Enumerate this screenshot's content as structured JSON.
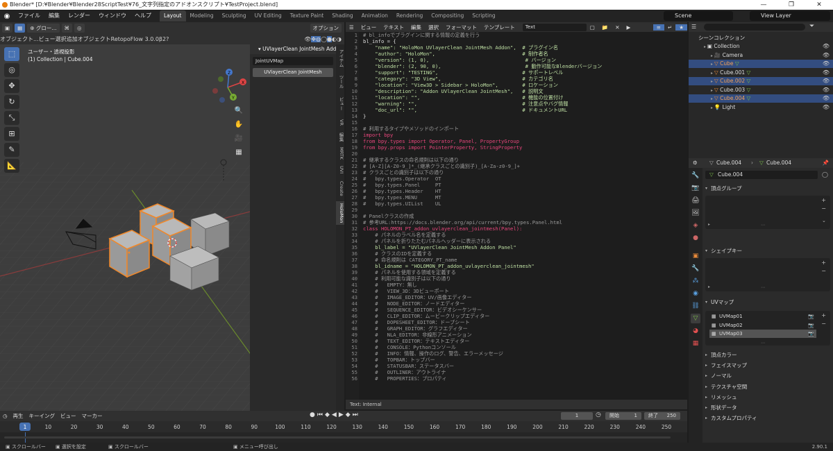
{
  "window": {
    "title": "Blender* [D:¥Blender¥Blender28ScriptTest¥76_文字列指定のアドオンスクリプト¥TestProject.blend]",
    "controls": [
      "—",
      "❐",
      "✕"
    ]
  },
  "menu": [
    "ファイル",
    "編集",
    "レンダー",
    "ウィンドウ",
    "ヘルプ"
  ],
  "workspaces": [
    "Layout",
    "Modeling",
    "Sculpting",
    "UV Editing",
    "Texture Paint",
    "Shading",
    "Animation",
    "Rendering",
    "Compositing",
    "Scripting"
  ],
  "active_workspace": "Layout",
  "scene": "Scene",
  "view_layer": "View Layer",
  "viewport": {
    "mode": "オブジェクト...",
    "orientation": "グロー...",
    "menus": [
      "ビュー",
      "選択",
      "追加",
      "オブジェクト"
    ],
    "addon_label": "RetopoFlow 3.0.0β2",
    "options_label": "オプション",
    "view_name": "ユーザー・透視投影",
    "collection_info": "(1) Collection | Cube.004",
    "tool_icons": [
      "select-box-icon",
      "cursor-icon",
      "move-icon",
      "rotate-icon",
      "scale-icon",
      "transform-icon",
      "annotate-icon",
      "measure-icon"
    ],
    "gizmo_axes": [
      "X",
      "Y",
      "Z"
    ]
  },
  "npanel": {
    "panel_title": "UVlayerClean JointMesh Addon",
    "input_value": "JointUVMap",
    "button_label": "UVlayerClean JointMesh",
    "tabs": [
      "アイテム",
      "ツール",
      "ビュー",
      "VR",
      "編集",
      "MRTK",
      "UVI",
      "Create",
      "HoloMon"
    ],
    "active_tab": "HoloMon"
  },
  "text_editor": {
    "menus": [
      "ビュー",
      "テキスト",
      "編集",
      "選択",
      "フォーマット",
      "テンプレート"
    ],
    "text_name": "Text",
    "footer": "Text: Internal",
    "lines": [
      "# bl_infoでプラグインに関する情報の定義を行う",
      "bl_info = {",
      "    \"name\": \"HoloMon UVlayerClean JointMesh Addon\",  # プラグイン名",
      "    \"author\": \"HoloMon\",                             # 制作者名",
      "    \"version\": (1, 0),                                # バージョン",
      "    \"blender\": (2, 90, 0),                            # 動作可能なBlenderバージョン",
      "    \"support\": \"TESTING\",                            # サポートレベル",
      "    \"category\": \"3D View\",                           # カテゴリ名",
      "    \"location\": \"View3D > Sidebar > HoloMon\",        # ロケーション",
      "    \"description\": \"Addon UVlayerClean JointMesh\",   # 説明文",
      "    \"location\": \"\",                                  # 機能の位置付け",
      "    \"warning\": \"\",                                   # 注意点やバグ情報",
      "    \"doc_url\": \"\",                                   # ドキュメントURL",
      "}",
      "",
      "# 利用するタイプやメソッドのインポート",
      "import bpy",
      "from bpy.types import Operator, Panel, PropertyGroup",
      "from bpy.props import PointerProperty, StringProperty",
      "",
      "# 継承するクラスの命名規則は以下の通り",
      "# [A-Z][A-Z0-9_]*_(継承クラスごとの識別子)_[A-Za-z0-9_]+",
      "# クラスごとの識別子は以下の通り",
      "#   bpy.types.Operator  OT",
      "#   bpy.types.Panel     PT",
      "#   bpy.types.Header    HT",
      "#   bpy.types.MENU      MT",
      "#   bpy.types.UIList    UL",
      "",
      "# Panelクラスの作成",
      "# 参考URL:https://docs.blender.org/api/current/bpy.types.Panel.html",
      "class HOLOMON_PT_addon_uvlayerclean_jointmesh(Panel):",
      "    # パネルのラベル名を定義する",
      "    # パネルを折りたたむパネルヘッダーに表示される",
      "    bl_label = \"UVlayerClean JointMesh Addon Panel\"",
      "    # クラスのIDを定義する",
      "    # 命名規則は CATEGORY_PT_name",
      "    bl_idname = \"HOLOMON_PT_addon_uvlayerclean_jointmesh\"",
      "    # パネルを使用する領域を定義する",
      "    # 利用可能な識別子は以下の通り",
      "    #   EMPTY：無し",
      "    #   VIEW_3D：3Dビューポート",
      "    #   IMAGE_EDITOR：UV/画像エディター",
      "    #   NODE_EDITOR：ノードエディター",
      "    #   SEQUENCE_EDITOR：ビデオシーケンサー",
      "    #   CLIP_EDITOR：ムービークリップエディター",
      "    #   DOPESHEET_EDITOR：ドープシート",
      "    #   GRAPH_EDITOR：グラフエディター",
      "    #   NLA_EDITOR：非線形アニメーション",
      "    #   TEXT_EDITOR：テキストエディター",
      "    #   CONSOLE：Pythonコンソール",
      "    #   INFO：情報、操作のログ、警告、エラーメッセージ",
      "    #   TOPBAR：トップバー",
      "    #   STATUSBAR：ステータスバー",
      "    #   OUTLINER：アウトライナ",
      "    #   PROPERTIES：プロパティ"
    ]
  },
  "outliner": {
    "root": "シーンコレクション",
    "items": [
      {
        "label": "Collection",
        "icon": "collection-icon",
        "selected": false,
        "level": 1
      },
      {
        "label": "Camera",
        "icon": "camera-icon",
        "selected": false,
        "level": 2
      },
      {
        "label": "Cube",
        "icon": "mesh-icon",
        "selected": true,
        "level": 2
      },
      {
        "label": "Cube.001",
        "icon": "mesh-icon",
        "selected": false,
        "level": 2
      },
      {
        "label": "Cube.002",
        "icon": "mesh-icon",
        "selected": true,
        "level": 2
      },
      {
        "label": "Cube.003",
        "icon": "mesh-icon",
        "selected": false,
        "level": 2
      },
      {
        "label": "Cube.004",
        "icon": "mesh-icon",
        "selected": true,
        "level": 2
      },
      {
        "label": "Light",
        "icon": "light-icon",
        "selected": false,
        "level": 2
      }
    ]
  },
  "properties": {
    "breadcrumb_object": "Cube.004",
    "breadcrumb_data": "Cube.004",
    "data_name": "Cube.004",
    "sections_top": [
      "頂点グループ",
      "シェイプキー",
      "UVマップ"
    ],
    "uv_maps": [
      "UVMap01",
      "UVMap02",
      "UVMap03"
    ],
    "active_uv_index": 2,
    "sections_collapsed": [
      "頂点カラー",
      "フェイスマップ",
      "ノーマル",
      "テクスチャ空間",
      "リメッシュ",
      "形状データ",
      "カスタムプロパティ"
    ]
  },
  "timeline": {
    "menus": [
      "再生",
      "キーイング",
      "ビュー",
      "マーカー"
    ],
    "current_frame": "1",
    "start_label": "開始",
    "start_value": "1",
    "end_label": "終了",
    "end_value": "250",
    "ticks": [
      "1",
      "10",
      "20",
      "30",
      "40",
      "50",
      "60",
      "70",
      "80",
      "90",
      "100",
      "110",
      "120",
      "130",
      "140",
      "150",
      "160",
      "170",
      "180",
      "190",
      "200",
      "210",
      "220",
      "230",
      "240",
      "250"
    ]
  },
  "statusbar": {
    "items": [
      "スクロールバー",
      "選択を設定",
      "スクロールバー",
      "メニュー呼び出し"
    ],
    "version": "2.90.1"
  },
  "colors": {
    "accent_blue": "#4772b3",
    "selection_orange": "#f0882a",
    "code_keyword": "#e8467c",
    "code_string": "#bfe0a4",
    "code_comment": "#9a9a9a"
  }
}
